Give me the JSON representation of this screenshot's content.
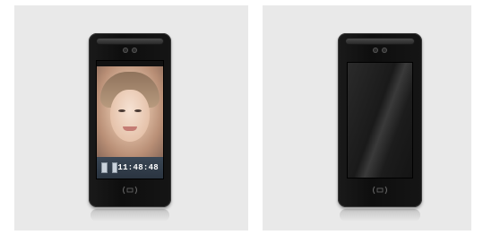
{
  "left_device": {
    "clock_time": "11:48:48",
    "icons": [
      "app-icon",
      "settings-icon"
    ],
    "nfc_icon": "nfc-reader-icon"
  },
  "right_device": {
    "nfc_icon": "nfc-reader-icon"
  }
}
